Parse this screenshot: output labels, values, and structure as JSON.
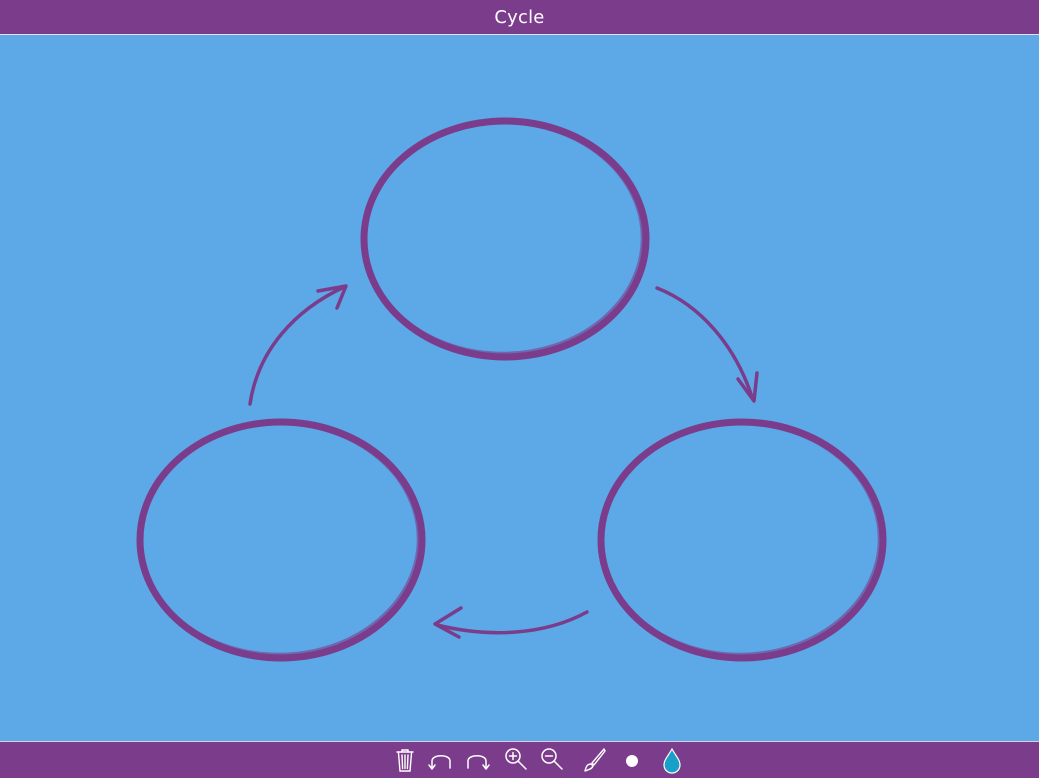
{
  "window": {
    "title": "Cycle"
  },
  "colors": {
    "header_bg": "#7b3c8c",
    "canvas_bg": "#5da8e6",
    "stroke": "#7b3c8c",
    "icon": "#ffffff",
    "ink_drop": "#1aa0c8"
  },
  "diagram": {
    "type": "cycle",
    "nodes": [
      "top-circle",
      "bottom-right-circle",
      "bottom-left-circle"
    ],
    "arrows": [
      "top-to-bottom-right",
      "bottom-right-to-bottom-left",
      "bottom-left-to-top"
    ]
  },
  "toolbar": {
    "tools": [
      {
        "icon": "trash-icon"
      },
      {
        "icon": "undo-icon"
      },
      {
        "icon": "redo-icon"
      },
      {
        "icon": "zoom-in-icon"
      },
      {
        "icon": "zoom-out-icon"
      },
      {
        "icon": "brush-icon"
      },
      {
        "icon": "brush-size-icon"
      },
      {
        "icon": "color-drop-icon"
      }
    ]
  }
}
